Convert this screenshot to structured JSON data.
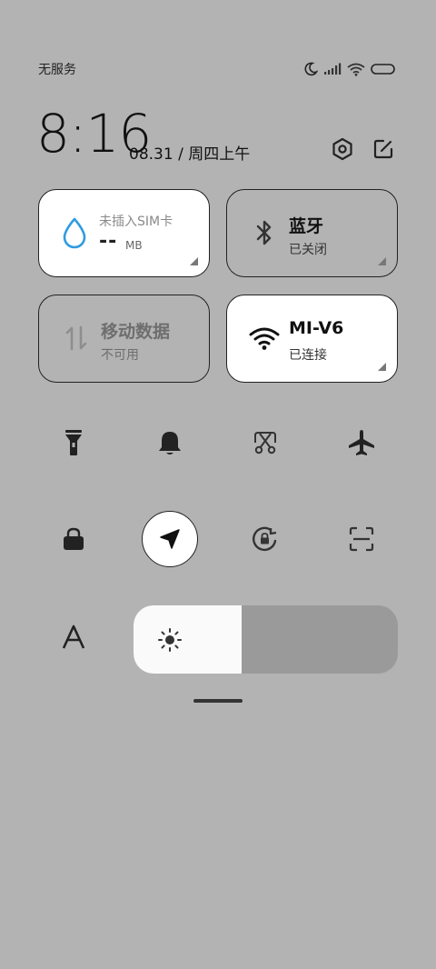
{
  "status_bar": {
    "carrier": "无服务",
    "icons": [
      "moon-icon",
      "signal-icon",
      "wifi-icon",
      "battery-icon"
    ]
  },
  "header": {
    "time": "8:16",
    "date": "08.31 / 周四上午",
    "settings_icon": "settings-icon",
    "edit_icon": "edit-icon"
  },
  "tiles": {
    "data_usage": {
      "title": "未插入SIM卡",
      "value": "--",
      "unit": "MB",
      "active": true,
      "accent": "#2f9be0"
    },
    "bluetooth": {
      "title": "蓝牙",
      "subtitle": "已关闭",
      "active": false
    },
    "mobile_data": {
      "title": "移动数据",
      "subtitle": "不可用",
      "active": false
    },
    "wifi": {
      "title": "MI-V6",
      "subtitle": "已连接",
      "active": true
    }
  },
  "toggles_row1": [
    "flashlight-icon",
    "bell-icon",
    "screenshot-icon",
    "airplane-icon"
  ],
  "toggles_row2": [
    "lock-icon",
    "location-icon",
    "rotation-lock-icon",
    "scan-icon"
  ],
  "brightness": {
    "level": 0.41,
    "font_label": "A"
  }
}
